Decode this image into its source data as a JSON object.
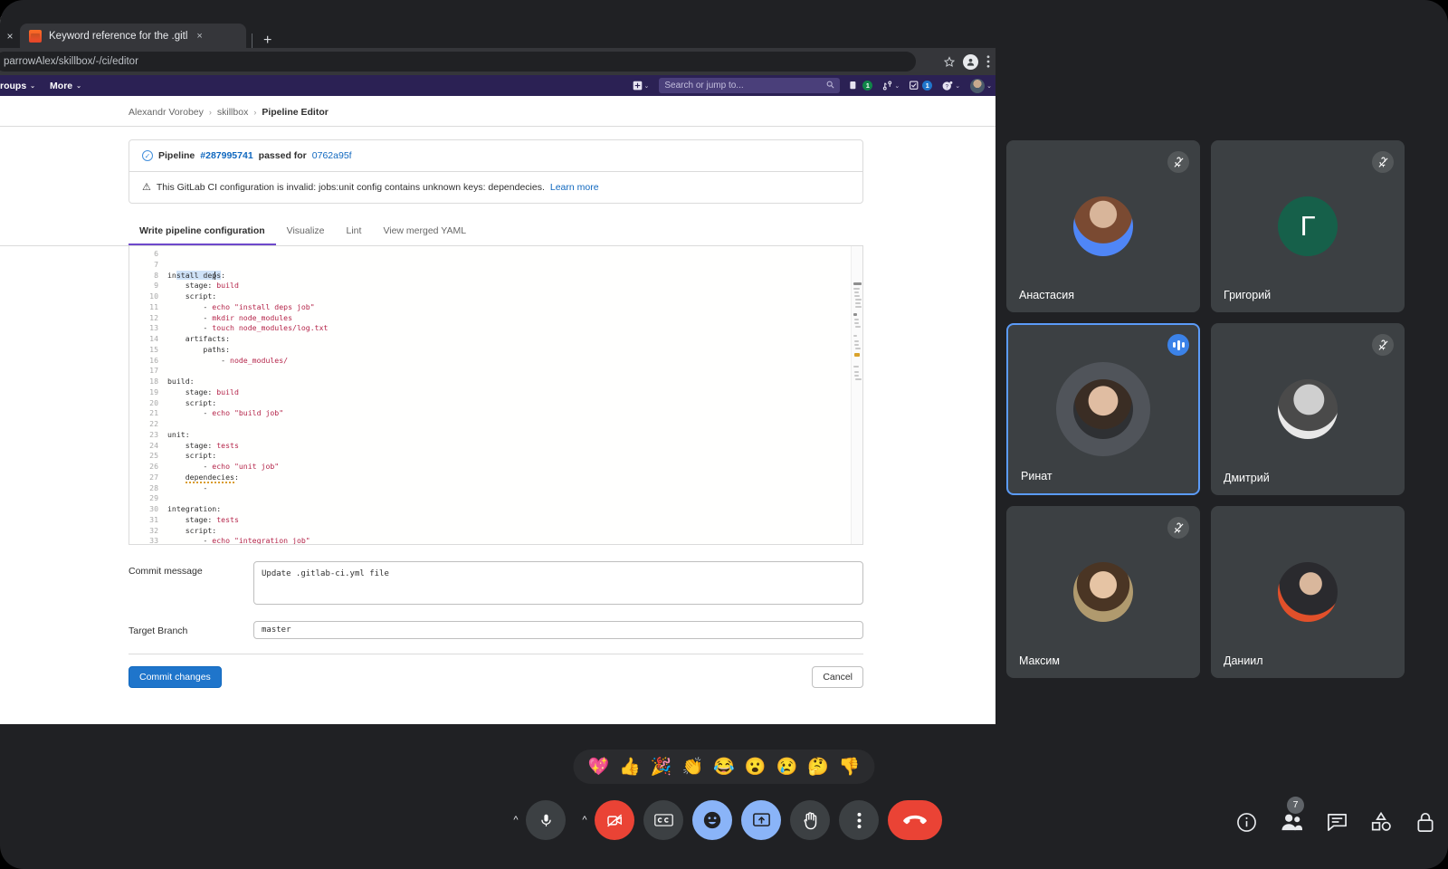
{
  "browser": {
    "tab": {
      "title": "Keyword reference for the .gitl",
      "favicon": "gitlab-favicon",
      "close_label": "×",
      "new_tab_label": "+"
    },
    "leading_close_label": "×",
    "url": "parrowAlex/skillbox/-/ci/editor",
    "actions": [
      "bookmark-star-icon",
      "profile-avatar-icon",
      "browser-menu-icon"
    ]
  },
  "gitlab": {
    "nav_left": [
      {
        "label": "roups",
        "caret": "⌄"
      },
      {
        "label": "More",
        "caret": "⌄"
      }
    ],
    "nav_right": {
      "plus_label": "+",
      "search_placeholder": "Search or jump to...",
      "issues_badge": "1",
      "merge_requests_badge": "",
      "todos_badge": "1",
      "help_label": "?"
    },
    "breadcrumb": [
      {
        "label": "Alexandr Vorobey",
        "strong": false
      },
      {
        "label": "skillbox",
        "strong": false
      },
      {
        "label": "Pipeline Editor",
        "strong": true
      }
    ],
    "alerts": [
      {
        "icon": "check-circle-icon",
        "parts": [
          {
            "text": "Pipeline ",
            "style": "bold"
          },
          {
            "text": "#287995741",
            "style": "link-bold"
          },
          {
            "text": " passed for ",
            "style": "bold"
          },
          {
            "text": "0762a95f",
            "style": "link"
          }
        ]
      },
      {
        "icon": "warning-triangle-icon",
        "parts": [
          {
            "text": "This GitLab CI configuration is invalid: jobs:unit config contains unknown keys: dependecies. ",
            "style": "plain"
          },
          {
            "text": "Learn more",
            "style": "link"
          }
        ]
      }
    ],
    "editor_tabs": [
      {
        "label": "Write pipeline configuration",
        "active": true
      },
      {
        "label": "Visualize",
        "active": false
      },
      {
        "label": "Lint",
        "active": false
      },
      {
        "label": "View merged YAML",
        "active": false
      }
    ],
    "code_lines": [
      {
        "n": "6",
        "text": ""
      },
      {
        "n": "7",
        "text": ""
      },
      {
        "n": "8",
        "text": "install deps:",
        "tokens": [
          {
            "t": "in",
            "c": "tk-key"
          },
          {
            "t": "stall deps",
            "c": "tk-key hl"
          },
          {
            "t": ":",
            "c": "tk-key"
          }
        ]
      },
      {
        "n": "9",
        "text": "    stage: build",
        "tokens": [
          {
            "t": "    stage: ",
            "c": "tk-key"
          },
          {
            "t": "build",
            "c": "tk-val"
          }
        ]
      },
      {
        "n": "10",
        "text": "    script:",
        "tokens": [
          {
            "t": "    script:",
            "c": "tk-key"
          }
        ]
      },
      {
        "n": "11",
        "text": "        - echo \"install deps job\"",
        "tokens": [
          {
            "t": "        - ",
            "c": "tk-key"
          },
          {
            "t": "echo \"install deps job\"",
            "c": "tk-str"
          }
        ]
      },
      {
        "n": "12",
        "text": "        - mkdir node_modules",
        "tokens": [
          {
            "t": "        - ",
            "c": "tk-key"
          },
          {
            "t": "mkdir node_modules",
            "c": "tk-str"
          }
        ]
      },
      {
        "n": "13",
        "text": "        - touch node_modules/log.txt",
        "tokens": [
          {
            "t": "        - ",
            "c": "tk-key"
          },
          {
            "t": "touch node_modules/log.txt",
            "c": "tk-str"
          }
        ]
      },
      {
        "n": "14",
        "text": "    artifacts:",
        "tokens": [
          {
            "t": "    artifacts:",
            "c": "tk-key"
          }
        ]
      },
      {
        "n": "15",
        "text": "        paths:",
        "tokens": [
          {
            "t": "        paths:",
            "c": "tk-key"
          }
        ]
      },
      {
        "n": "16",
        "text": "            - node_modules/",
        "tokens": [
          {
            "t": "            - ",
            "c": "tk-key"
          },
          {
            "t": "node_modules/",
            "c": "tk-str"
          }
        ]
      },
      {
        "n": "17",
        "text": ""
      },
      {
        "n": "18",
        "text": "build:",
        "tokens": [
          {
            "t": "build:",
            "c": "tk-key"
          }
        ]
      },
      {
        "n": "19",
        "text": "    stage: build",
        "tokens": [
          {
            "t": "    stage: ",
            "c": "tk-key"
          },
          {
            "t": "build",
            "c": "tk-val"
          }
        ]
      },
      {
        "n": "20",
        "text": "    script:",
        "tokens": [
          {
            "t": "    script:",
            "c": "tk-key"
          }
        ]
      },
      {
        "n": "21",
        "text": "        - echo \"build job\"",
        "tokens": [
          {
            "t": "        - ",
            "c": "tk-key"
          },
          {
            "t": "echo \"build job\"",
            "c": "tk-str"
          }
        ]
      },
      {
        "n": "22",
        "text": ""
      },
      {
        "n": "23",
        "text": "unit:",
        "tokens": [
          {
            "t": "unit:",
            "c": "tk-key"
          }
        ]
      },
      {
        "n": "24",
        "text": "    stage: tests",
        "tokens": [
          {
            "t": "    stage: ",
            "c": "tk-key"
          },
          {
            "t": "tests",
            "c": "tk-val"
          }
        ]
      },
      {
        "n": "25",
        "text": "    script:",
        "tokens": [
          {
            "t": "    script:",
            "c": "tk-key"
          }
        ]
      },
      {
        "n": "26",
        "text": "        - echo \"unit job\"",
        "tokens": [
          {
            "t": "        - ",
            "c": "tk-key"
          },
          {
            "t": "echo \"unit job\"",
            "c": "tk-str"
          }
        ]
      },
      {
        "n": "27",
        "text": "    dependecies:",
        "tokens": [
          {
            "t": "    ",
            "c": "tk-key"
          },
          {
            "t": "dependecies",
            "c": "tk-key sq"
          },
          {
            "t": ":",
            "c": "tk-key"
          }
        ]
      },
      {
        "n": "28",
        "text": "        -",
        "tokens": [
          {
            "t": "        -",
            "c": "tk-key"
          }
        ]
      },
      {
        "n": "29",
        "text": ""
      },
      {
        "n": "30",
        "text": "integration:",
        "tokens": [
          {
            "t": "integration:",
            "c": "tk-key"
          }
        ]
      },
      {
        "n": "31",
        "text": "    stage: tests",
        "tokens": [
          {
            "t": "    stage: ",
            "c": "tk-key"
          },
          {
            "t": "tests",
            "c": "tk-val"
          }
        ]
      },
      {
        "n": "32",
        "text": "    script:",
        "tokens": [
          {
            "t": "    script:",
            "c": "tk-key"
          }
        ]
      },
      {
        "n": "33",
        "text": "        - echo \"integration job\"",
        "tokens": [
          {
            "t": "        - ",
            "c": "tk-key"
          },
          {
            "t": "echo \"integration job\"",
            "c": "tk-str"
          }
        ]
      }
    ],
    "form": {
      "commit_label": "Commit message",
      "commit_value": "Update .gitlab-ci.yml file",
      "branch_label": "Target Branch",
      "branch_value": "master",
      "submit_label": "Commit changes",
      "cancel_label": "Cancel"
    }
  },
  "meet": {
    "participants": [
      {
        "name": "Анастасия",
        "muted": true,
        "speaking": false,
        "avatar_type": "photo",
        "avatar_style": "photo-anastasia"
      },
      {
        "name": "Григорий",
        "muted": true,
        "speaking": false,
        "avatar_type": "initial",
        "initial": "Г",
        "avatar_color": "#16604a"
      },
      {
        "name": "Ринат",
        "muted": false,
        "speaking": true,
        "avatar_type": "photo",
        "avatar_style": "photo-rinat"
      },
      {
        "name": "Дмитрий",
        "muted": true,
        "speaking": false,
        "avatar_type": "photo",
        "avatar_style": "photo-dmitry"
      },
      {
        "name": "Максим",
        "muted": true,
        "speaking": false,
        "avatar_type": "photo",
        "avatar_style": "photo-maxim"
      },
      {
        "name": "Даниил",
        "muted": false,
        "speaking": false,
        "avatar_type": "photo",
        "avatar_style": "photo-daniil"
      }
    ],
    "reactions": [
      {
        "emoji": "💖",
        "name": "sparkling-heart"
      },
      {
        "emoji": "👍",
        "name": "thumbs-up"
      },
      {
        "emoji": "🎉",
        "name": "party-popper"
      },
      {
        "emoji": "👏",
        "name": "clapping-hands"
      },
      {
        "emoji": "😂",
        "name": "face-with-tears-of-joy"
      },
      {
        "emoji": "😮",
        "name": "face-with-open-mouth"
      },
      {
        "emoji": "😢",
        "name": "crying-face"
      },
      {
        "emoji": "🤔",
        "name": "thinking-face"
      },
      {
        "emoji": "👎",
        "name": "thumbs-down"
      }
    ],
    "controls": [
      {
        "name": "mic-options",
        "kind": "chevron",
        "label": "⌃"
      },
      {
        "name": "microphone",
        "kind": "dark",
        "label": ""
      },
      {
        "name": "camera-options",
        "kind": "chevron",
        "label": "⌃"
      },
      {
        "name": "camera-off",
        "kind": "red",
        "label": ""
      },
      {
        "name": "captions",
        "kind": "dark",
        "label": "CC"
      },
      {
        "name": "reactions",
        "kind": "blue",
        "label": ""
      },
      {
        "name": "present-screen",
        "kind": "blue",
        "label": ""
      },
      {
        "name": "raise-hand",
        "kind": "dark",
        "label": ""
      },
      {
        "name": "more-options",
        "kind": "dark",
        "label": ""
      },
      {
        "name": "leave-call",
        "kind": "hangup",
        "label": ""
      }
    ],
    "right_actions": [
      {
        "name": "meeting-details",
        "icon": "info-icon",
        "badge": ""
      },
      {
        "name": "people",
        "icon": "people-icon",
        "badge": "7"
      },
      {
        "name": "chat",
        "icon": "chat-icon",
        "badge": ""
      },
      {
        "name": "activities",
        "icon": "activities-icon",
        "badge": ""
      },
      {
        "name": "host-controls",
        "icon": "lock-icon",
        "badge": ""
      }
    ]
  },
  "colors": {
    "gitlab_nav": "#2b2154",
    "meet_bg": "#202124",
    "tile_bg": "#3c4043",
    "accent_blue": "#8ab4f8",
    "danger_red": "#ea4335",
    "speaking_border": "#5b9bf8"
  }
}
